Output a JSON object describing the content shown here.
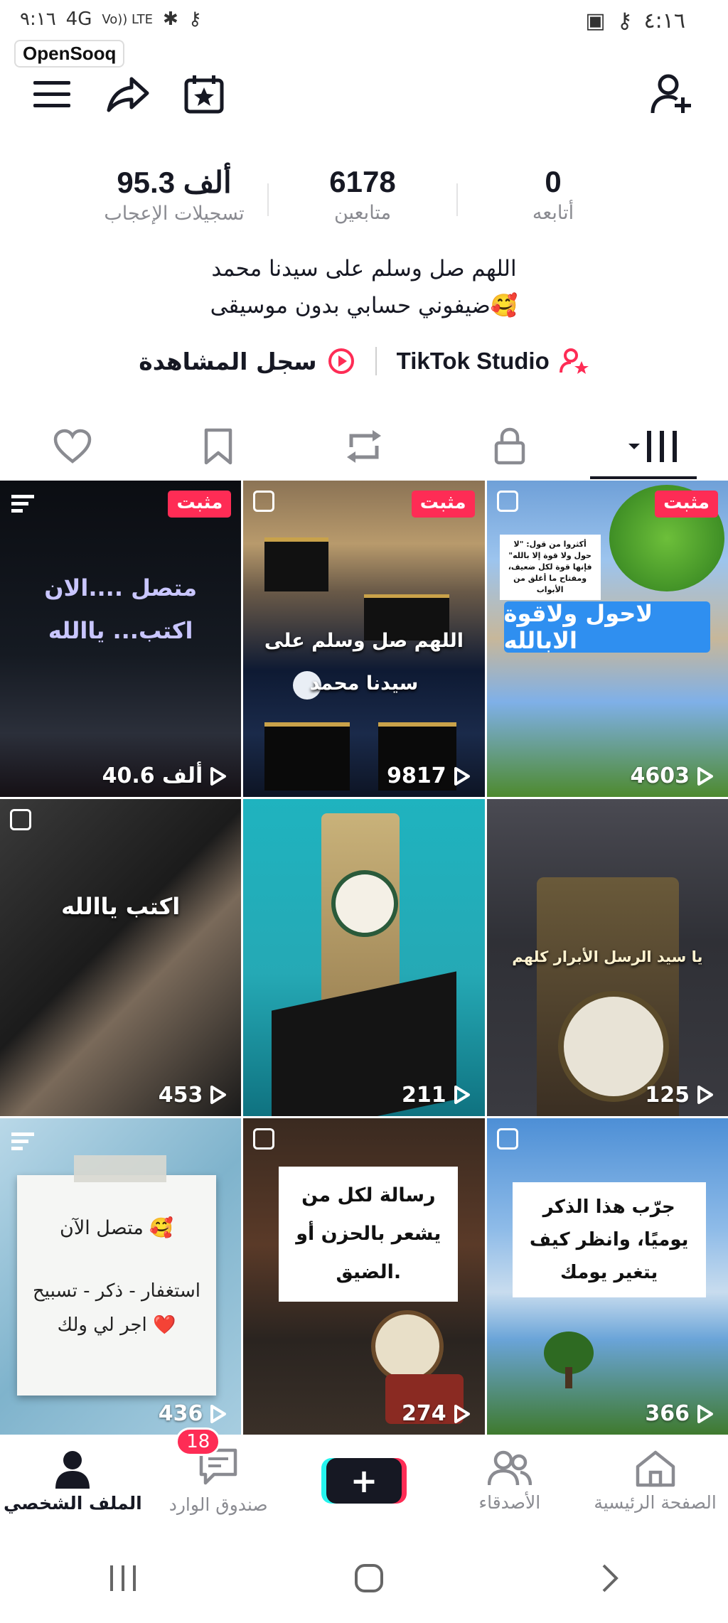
{
  "status_bar": {
    "time": "٤:١٦",
    "left_text": "٩:١٦",
    "network": "4G",
    "volte": "Vo)) LTE"
  },
  "watermark": "OpenSooq",
  "stats": [
    {
      "value": "0",
      "label": "أتابعه"
    },
    {
      "value": "6178",
      "label": "متابعين"
    },
    {
      "value": "95.3 ألف",
      "label": "تسجيلات الإعجاب"
    }
  ],
  "bio": {
    "line1": "اللهم صل وسلم على سيدنا محمد",
    "line2": "ضيفوني حسابي بدون موسيقى🥰"
  },
  "links": {
    "studio": "TikTok Studio",
    "history": "سجل المشاهدة"
  },
  "videos": [
    {
      "pinned": "مثبت",
      "views": "4603",
      "caption": "لاحول ولاقوة الابالله",
      "small_card": "أكثروا من قول: \"لا حول ولا قوة إلا بالله\" فإنها قوة لكل ضعيف، ومفتاح ما أغلق من الأبواب"
    },
    {
      "pinned": "مثبت",
      "views": "9817",
      "caption": "اللهم صل وسلم على سيدنا محمد"
    },
    {
      "pinned": "مثبت",
      "views": "40.6 ألف",
      "caption1": "متصل ....الان",
      "caption2": "اكتب... ياالله"
    },
    {
      "views": "125",
      "caption": "يا سيد الرسل الأبرار كلهم"
    },
    {
      "views": "211"
    },
    {
      "views": "453",
      "caption": "اكتب ياالله"
    },
    {
      "views": "366",
      "caption": "جرّب هذا الذكر يوميًا، وانظر كيف يتغير يومك"
    },
    {
      "views": "274",
      "caption": "رسالة لكل من يشعر بالحزن أو الضيق."
    },
    {
      "views": "436",
      "caption1": "متصل الآن 🥰",
      "caption2": "استغفار - ذكر - تسبيح",
      "caption3": "اجر لي ولك ❤️"
    }
  ],
  "bottom_nav": {
    "home": "الصفحة الرئيسية",
    "friends": "الأصدقاء",
    "inbox": "صندوق الوارد",
    "inbox_badge": "18",
    "profile": "الملف الشخصي"
  },
  "colors": {
    "accent": "#fe2c55",
    "cyan": "#25f4ee",
    "text": "#161823",
    "muted": "#8a8b91"
  }
}
